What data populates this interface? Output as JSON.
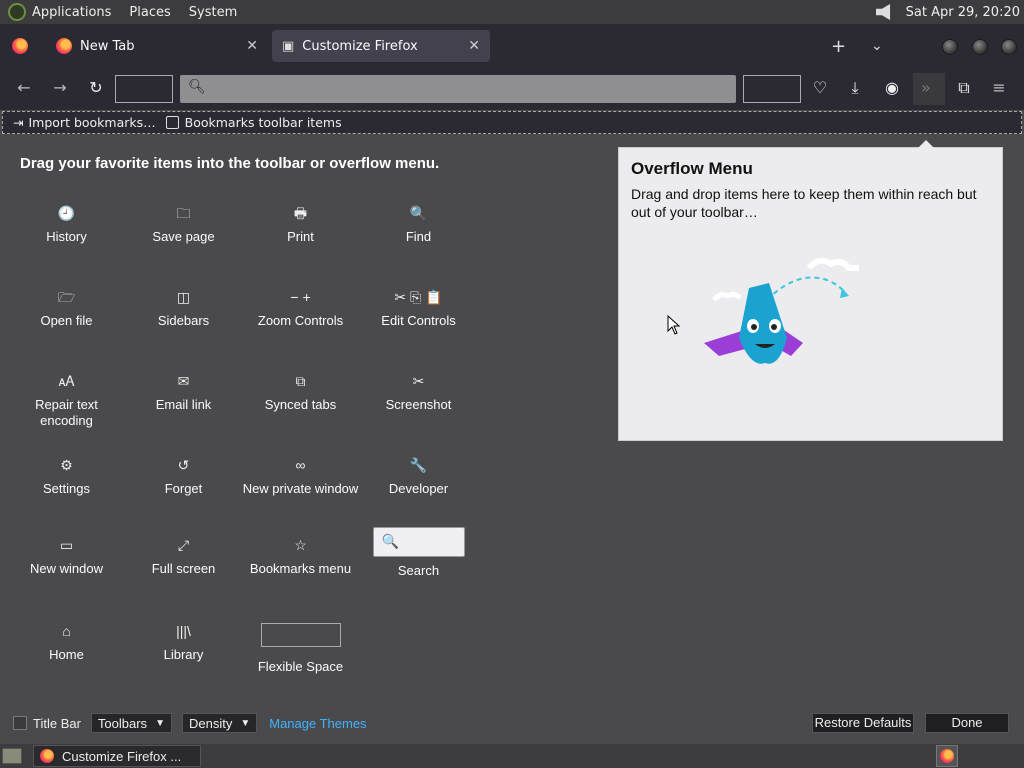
{
  "system_bar": {
    "menus": [
      "Applications",
      "Places",
      "System"
    ],
    "clock": "Sat Apr 29, 20:20"
  },
  "tabs": [
    {
      "label": "New Tab",
      "selected": false
    },
    {
      "label": "Customize Firefox",
      "selected": true
    }
  ],
  "bookmarks_bar": {
    "import_label": "Import bookmarks…",
    "toolbar_items_label": "Bookmarks toolbar items"
  },
  "customize": {
    "heading": "Drag your favorite items into the toolbar or overflow menu.",
    "items": [
      {
        "icon": "clock-icon",
        "glyph": "🕘",
        "label": "History"
      },
      {
        "icon": "save-page-icon",
        "glyph": "🗀",
        "label": "Save page"
      },
      {
        "icon": "printer-icon",
        "glyph": "🖶",
        "label": "Print"
      },
      {
        "icon": "search-icon",
        "glyph": "🔍",
        "label": "Find"
      },
      {
        "icon": "open-file-icon",
        "glyph": "🗁",
        "label": "Open file"
      },
      {
        "icon": "sidebar-icon",
        "glyph": "◫",
        "label": "Sidebars"
      },
      {
        "icon": "zoom-icon",
        "glyph": "− +",
        "label": "Zoom Controls"
      },
      {
        "icon": "edit-controls-icon",
        "glyph": "✂ ⎘ 📋",
        "label": "Edit Controls"
      },
      {
        "icon": "text-encoding-icon",
        "glyph": "🗚",
        "label": "Repair text encoding"
      },
      {
        "icon": "envelope-icon",
        "glyph": "✉",
        "label": "Email link"
      },
      {
        "icon": "synced-tabs-icon",
        "glyph": "⧉",
        "label": "Synced tabs"
      },
      {
        "icon": "screenshot-icon",
        "glyph": "✂",
        "label": "Screenshot"
      },
      {
        "icon": "gear-icon",
        "glyph": "⚙",
        "label": "Settings"
      },
      {
        "icon": "forget-icon",
        "glyph": "↺",
        "label": "Forget"
      },
      {
        "icon": "private-mask-icon",
        "glyph": "∞",
        "label": "New private window"
      },
      {
        "icon": "wrench-icon",
        "glyph": "🔧",
        "label": "Developer"
      },
      {
        "icon": "new-window-icon",
        "glyph": "▭",
        "label": "New window"
      },
      {
        "icon": "fullscreen-icon",
        "glyph": "⤢",
        "label": "Full screen"
      },
      {
        "icon": "bookmark-star-icon",
        "glyph": "☆",
        "label": "Bookmarks menu"
      },
      {
        "icon": "search-box-icon",
        "glyph": "🔍",
        "label": "Search"
      },
      {
        "icon": "home-icon",
        "glyph": "⌂",
        "label": "Home"
      },
      {
        "icon": "library-icon",
        "glyph": "|||\\",
        "label": "Library"
      },
      {
        "icon": "flexible-space-icon",
        "glyph": "",
        "label": "Flexible Space"
      }
    ]
  },
  "overflow_panel": {
    "title": "Overflow Menu",
    "description": "Drag and drop items here to keep them within reach but out of your toolbar…"
  },
  "footer": {
    "title_bar_label": "Title Bar",
    "toolbars_label": "Toolbars",
    "density_label": "Density",
    "manage_themes_label": "Manage Themes",
    "restore_defaults_label": "Restore Defaults",
    "done_label": "Done"
  },
  "taskbar": {
    "task_label": "Customize Firefox ..."
  },
  "colors": {
    "link": "#40b2ff",
    "background": "#4a4a4c",
    "toolbar": "#2b2a33"
  }
}
